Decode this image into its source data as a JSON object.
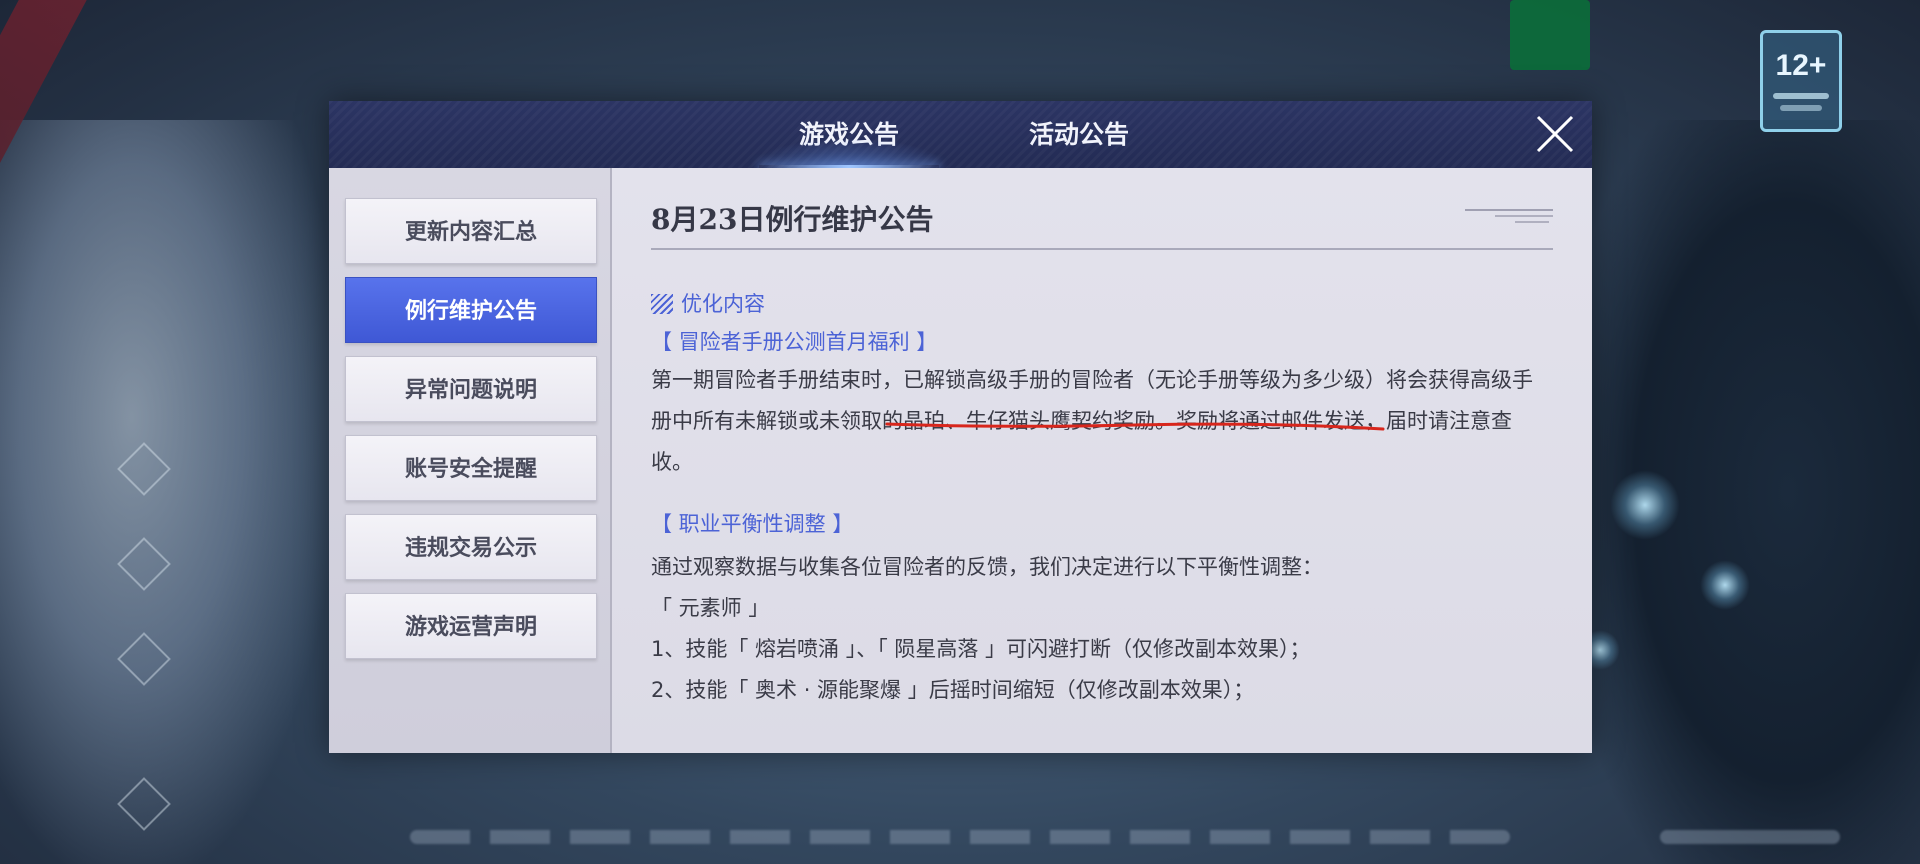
{
  "dialog": {
    "tabs": [
      {
        "label": "游戏公告",
        "active": true
      },
      {
        "label": "活动公告",
        "active": false
      }
    ],
    "close_icon": "close-icon"
  },
  "age_rating": {
    "label": "12+"
  },
  "sidebar": {
    "items": [
      {
        "label": "更新内容汇总",
        "active": false
      },
      {
        "label": "例行维护公告",
        "active": true
      },
      {
        "label": "异常问题说明",
        "active": false
      },
      {
        "label": "账号安全提醒",
        "active": false
      },
      {
        "label": "违规交易公示",
        "active": false
      },
      {
        "label": "游戏运营声明",
        "active": false
      }
    ]
  },
  "content": {
    "title": "8月23日例行维护公告",
    "section": "优化内容",
    "welfare_title": "【 冒险者手册公测首月福利 】",
    "welfare_text": "第一期冒险者手册结束时，已解锁高级手册的冒险者（无论手册等级为多少级）将会获得高级手册中所有未解锁或未领取的晶珀、牛仔猫头鹰契约奖励。奖励将通过邮件发送，届时请注意查收。",
    "balance_title": "【 职业平衡性调整 】",
    "balance_intro": "通过观察数据与收集各位冒险者的反馈，我们决定进行以下平衡性调整：",
    "class_name": "「 元素师 」",
    "items": [
      "1、技能「 熔岩喷涌 」、「 陨星高落 」可闪避打断（仅修改副本效果）；",
      "2、技能「 奥术 · 源能聚爆 」后摇时间缩短（仅修改副本效果）；"
    ]
  },
  "colors": {
    "accent": "#4c63d6",
    "header_bg": "#262e58",
    "active_item": "#4a63e0",
    "annotation": "#d8261c"
  }
}
